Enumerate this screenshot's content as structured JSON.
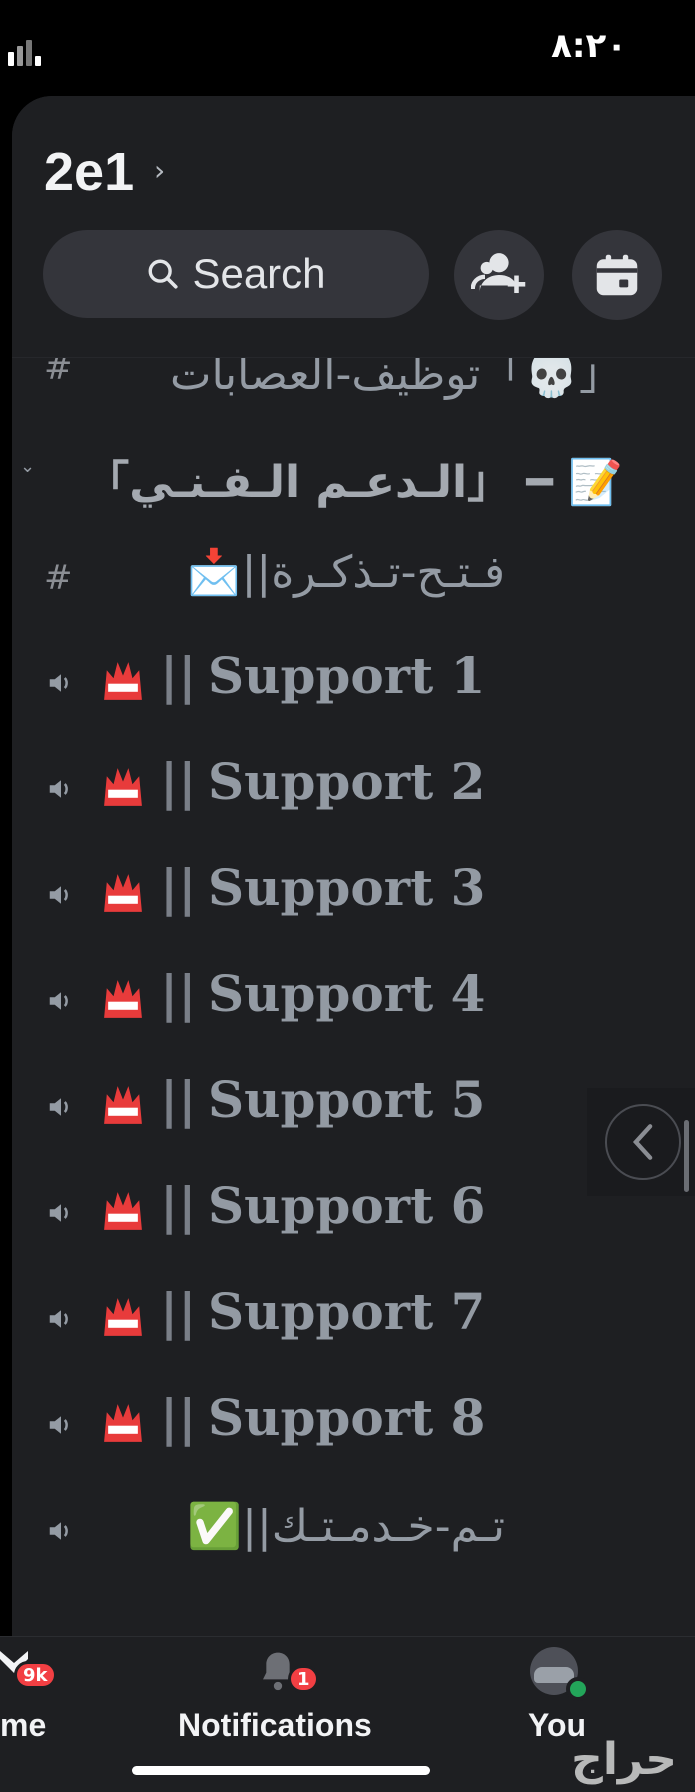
{
  "status_bar": {
    "time": "٨:٢٠"
  },
  "header": {
    "server_name": "2e1",
    "search_label": "Search",
    "invite_icon": "add-member-icon",
    "events_icon": "calendar-icon"
  },
  "channels": {
    "row0": {
      "type": "text",
      "name": "「💀」توظيف-العصابات"
    },
    "category": {
      "name": "📝 ━ 「الـدعـم الـفـنـي」",
      "icon": "collapse-chevron-icon"
    },
    "row1": {
      "type": "text",
      "name": "فـتـح-تـذكـرة||📩"
    },
    "voice": [
      {
        "name": "Support 1",
        "prefix": "||"
      },
      {
        "name": "Support 2",
        "prefix": "||"
      },
      {
        "name": "Support 3",
        "prefix": "||"
      },
      {
        "name": "Support 4",
        "prefix": "||"
      },
      {
        "name": "Support 5",
        "prefix": "||"
      },
      {
        "name": "Support 6",
        "prefix": "||"
      },
      {
        "name": "Support 7",
        "prefix": "||"
      },
      {
        "name": "Support 8",
        "prefix": "||"
      }
    ],
    "last": {
      "type": "voice",
      "name": "تـم-خـدمـتـك||✅"
    }
  },
  "tabbar": {
    "home_label": "me",
    "home_badge": "9k",
    "notifications_label": "Notifications",
    "notifications_badge": "1",
    "you_label": "You"
  },
  "watermark": "حراج",
  "colors": {
    "background": "#1e1f22",
    "accent_red": "#f23f43",
    "online": "#23a55a"
  }
}
